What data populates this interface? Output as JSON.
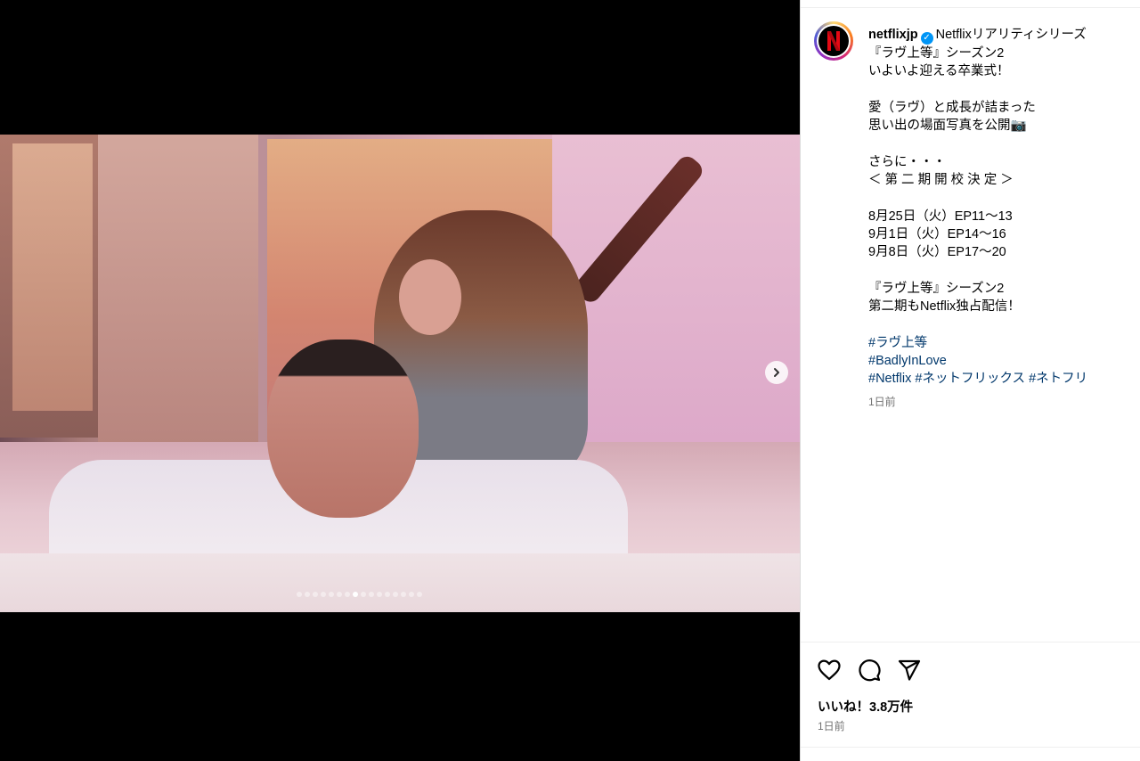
{
  "post": {
    "username": "netflixjp",
    "caption_lines": [
      "Netflixリアリティシリーズ",
      "『ラヴ上等』シーズン2",
      "いよいよ迎える卒業式！",
      "",
      "愛（ラヴ）と成長が詰まった",
      "思い出の場面写真を公開📷",
      "",
      "さらに・・・",
      "＜ 第 二 期 開 校 決 定 ＞",
      "",
      "8月25日（火）EP11〜13",
      "9月1日（火）EP14〜16",
      "9月8日（火）EP17〜20",
      "",
      "『ラヴ上等』シーズン2",
      "第二期もNetflix独占配信！"
    ],
    "hashtags": [
      "#ラヴ上等",
      "#BadlyInLove",
      "#Netflix",
      "#ネットフリックス",
      "#ネトフリ"
    ],
    "caption_time": "1日前",
    "likes": "いいね！3.8万件",
    "time": "1日前"
  },
  "carousel": {
    "total": 16,
    "active": 7
  },
  "icons": {
    "logo": "netflix-logo",
    "verified": "verified-badge-icon",
    "next": "chevron-right-icon",
    "like": "heart-icon",
    "comment": "comment-icon",
    "share": "share-icon"
  },
  "colors": {
    "netflix_red": "#e50914",
    "link": "#00376b",
    "verified": "#0095f6"
  }
}
